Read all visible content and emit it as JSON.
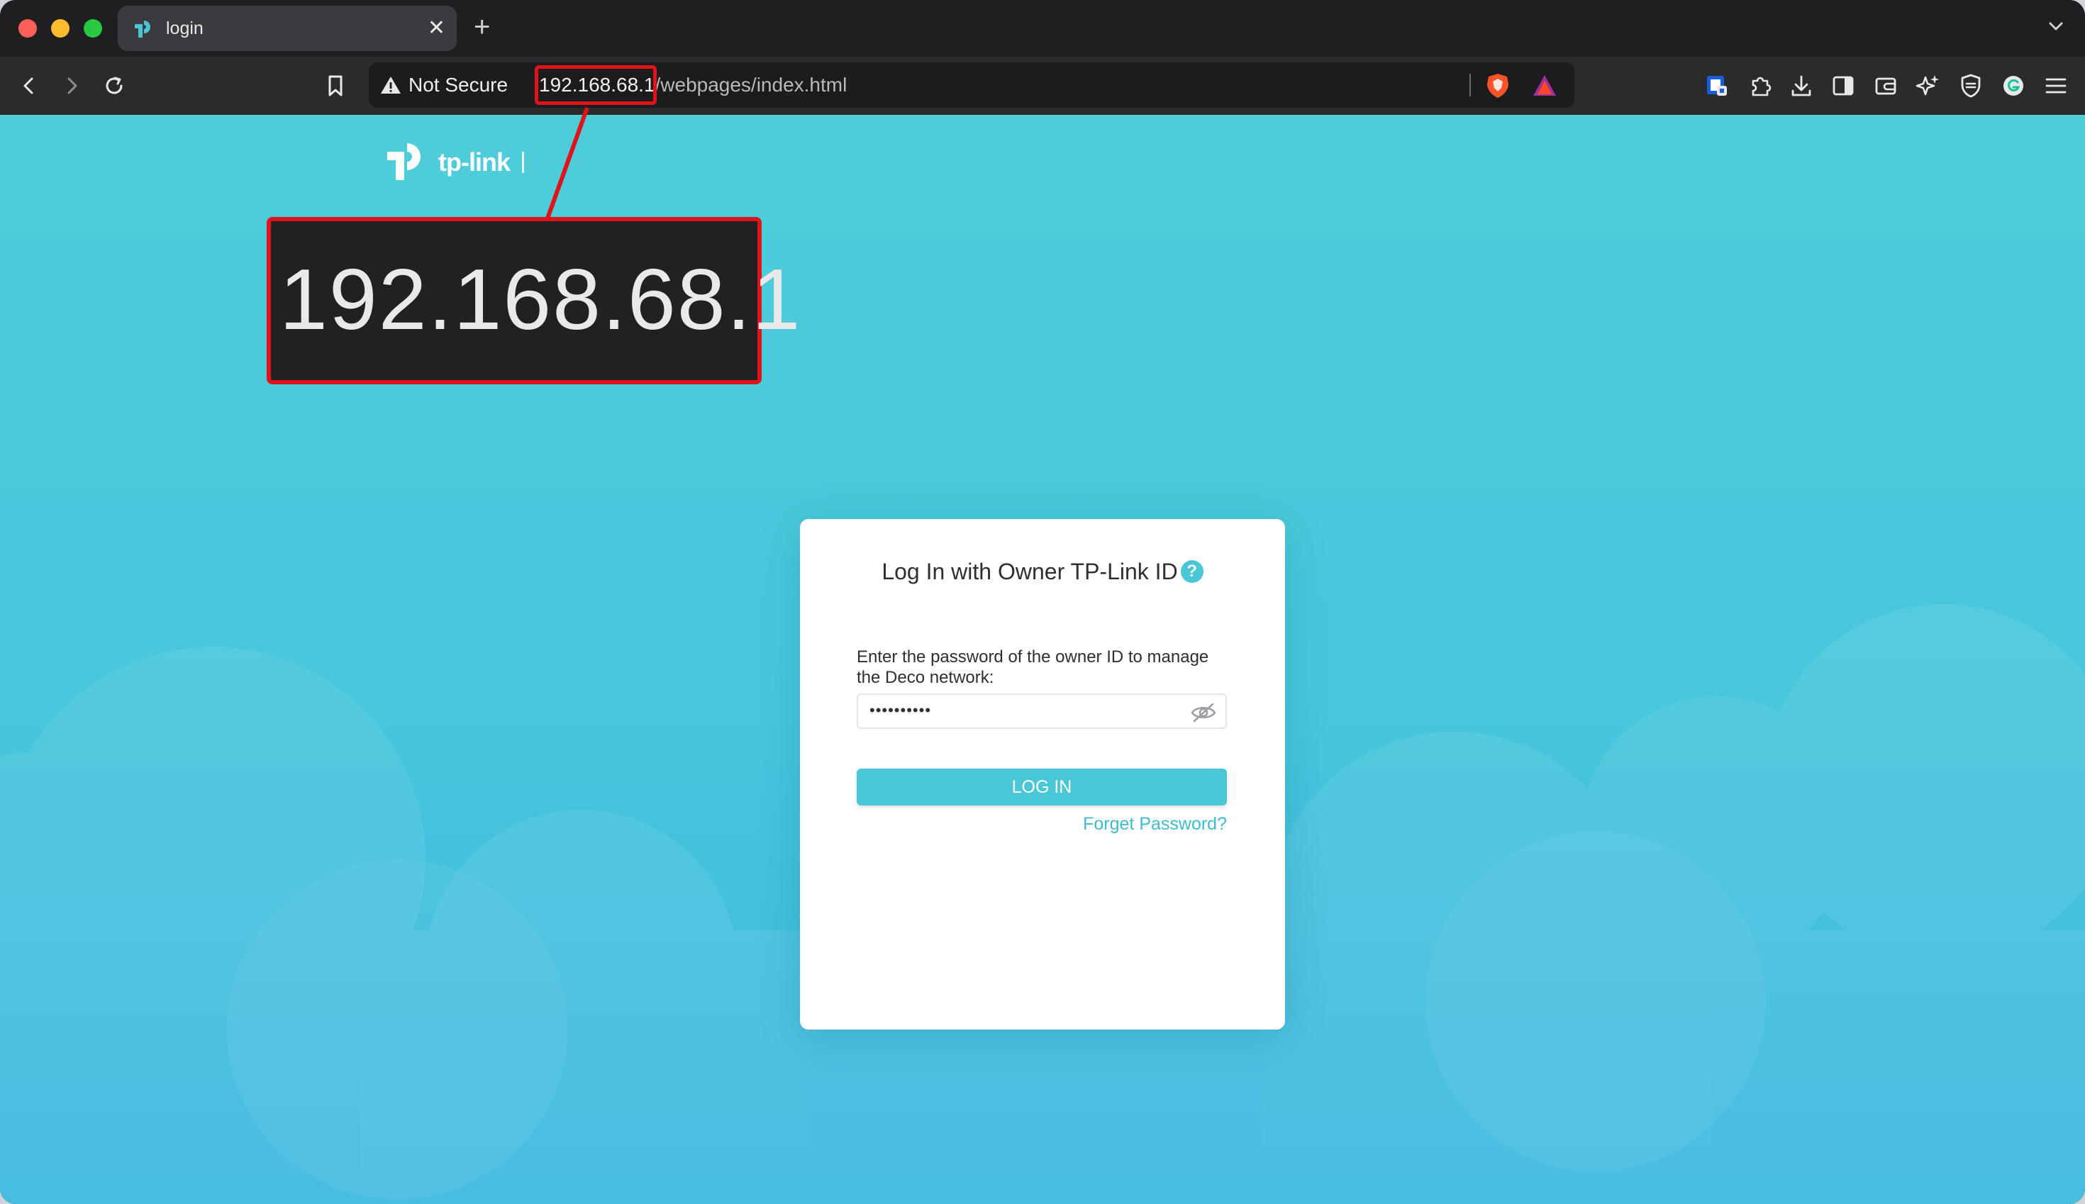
{
  "browser": {
    "tab": {
      "title": "login",
      "favicon": "tp-link-icon"
    },
    "new_tab": "+",
    "address": {
      "security_label": "Not Secure",
      "url_host": "192.168.68.1",
      "url_path": "/webpages/index.html"
    },
    "toolbar_icons": [
      "back-icon",
      "forward-icon",
      "reload-icon",
      "bookmark-icon",
      "brave-shields-icon",
      "brave-rewards-icon",
      "bitwarden-icon",
      "extensions-icon",
      "download-icon",
      "sidebar-icon",
      "wallet-icon",
      "leo-ai-icon",
      "vpn-icon",
      "grammarly-icon",
      "menu-icon"
    ]
  },
  "page": {
    "logo_text": "tp-link",
    "callout_text": "192.168.68.1",
    "login": {
      "title": "Log In with Owner TP-Link ID",
      "help": "?",
      "instruction": "Enter the password of the owner ID to manage the Deco network:",
      "password_masked": "••••••••••",
      "button": "LOG IN",
      "forget": "Forget Password?"
    }
  },
  "colors": {
    "accent": "#4ac7d6",
    "highlight": "#e0131a",
    "background_top": "#4ecdd9",
    "background_bottom": "#3bb8e0"
  }
}
